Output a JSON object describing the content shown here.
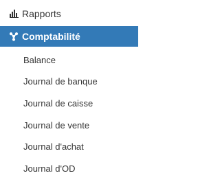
{
  "menu": {
    "rapports": {
      "label": "Rapports",
      "icon": "bar-chart-icon"
    },
    "comptabilite": {
      "label": "Comptabilité",
      "icon": "settings-cogs-icon",
      "active": true,
      "active_color": "#337ab7"
    },
    "submenu": [
      {
        "label": "Balance"
      },
      {
        "label": "Journal de banque"
      },
      {
        "label": "Journal de caisse"
      },
      {
        "label": "Journal de vente"
      },
      {
        "label": "Journal d'achat"
      },
      {
        "label": "Journal d'OD"
      }
    ]
  }
}
